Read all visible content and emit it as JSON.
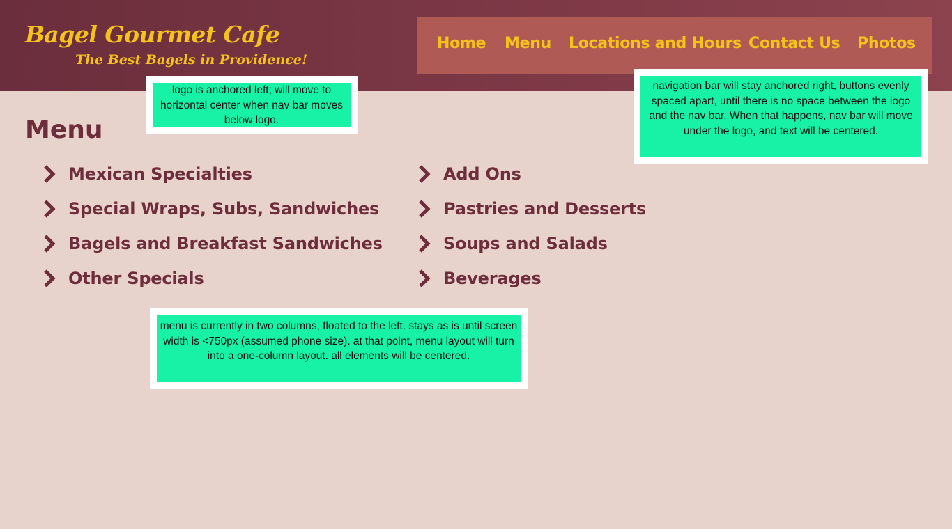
{
  "header": {
    "title": "Bagel Gourmet Cafe",
    "tagline": "The Best Bagels in Providence!"
  },
  "nav": {
    "items": [
      "Home",
      "Menu",
      "Locations and Hours",
      "Contact Us",
      "Photos"
    ]
  },
  "notes": {
    "logo": "logo is anchored left; will move to horizontal center when nav bar moves below logo.",
    "nav": "navigation bar will stay anchored right, buttons evenly spaced apart, until there is no space between the logo and the nav bar. When that happens, nav bar will move under the logo, and text will be centered.",
    "menu": "menu is currently in two columns, floated to the left. stays as is until screen width is <750px (assumed phone size). at that point, menu layout will turn into a one-column layout. all elements will be centered."
  },
  "main": {
    "title": "Menu",
    "left_column": [
      "Mexican Specialties",
      "Special Wraps, Subs, Sandwiches",
      "Bagels and Breakfast Sandwiches",
      "Other Specials"
    ],
    "right_column": [
      "Add Ons",
      "Pastries and Desserts",
      "Soups and Salads",
      "Beverages"
    ]
  },
  "icons": {
    "menu_item": "chevron-right-icon"
  },
  "colors": {
    "header_bg": "#7a3644",
    "nav_bg": "#b05a56",
    "accent_yellow": "#f4c21b",
    "maroon_text": "#6e2d3b",
    "page_bg": "#e8d3cc",
    "note_bg": "#17f2a6"
  }
}
